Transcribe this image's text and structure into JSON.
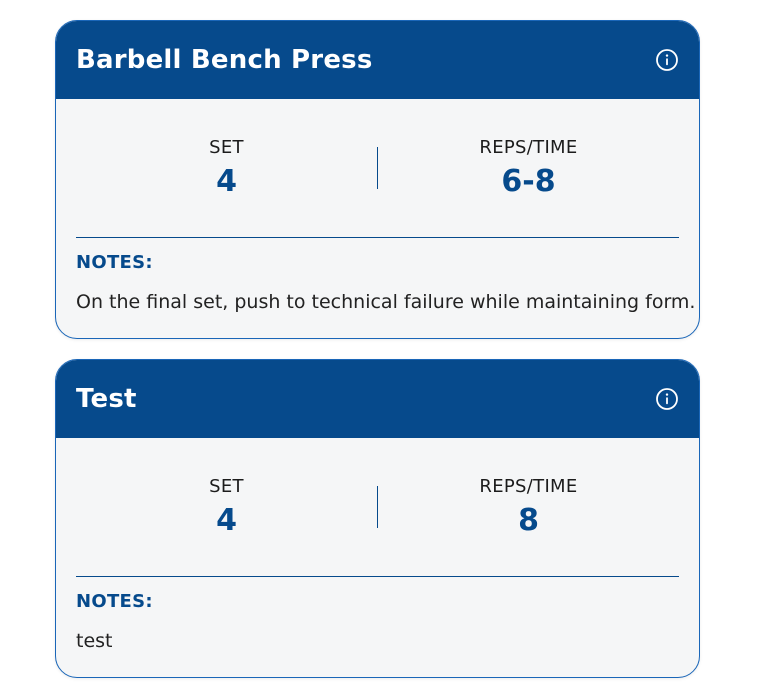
{
  "exercises": [
    {
      "title": "Barbell Bench Press",
      "set_label": "SET",
      "set_value": "4",
      "reps_label": "REPS/TIME",
      "reps_value": "6-8",
      "notes_label": "NOTES:",
      "notes_text": "On the final set, push to technical failure while maintaining form."
    },
    {
      "title": "Test",
      "set_label": "SET",
      "set_value": "4",
      "reps_label": "REPS/TIME",
      "reps_value": "8",
      "notes_label": "NOTES:",
      "notes_text": "test"
    }
  ],
  "icons": {
    "info": "info-circle-icon"
  },
  "colors": {
    "primary": "#064a8c",
    "card_background": "#f5f6f7",
    "border": "#1a66b8"
  }
}
